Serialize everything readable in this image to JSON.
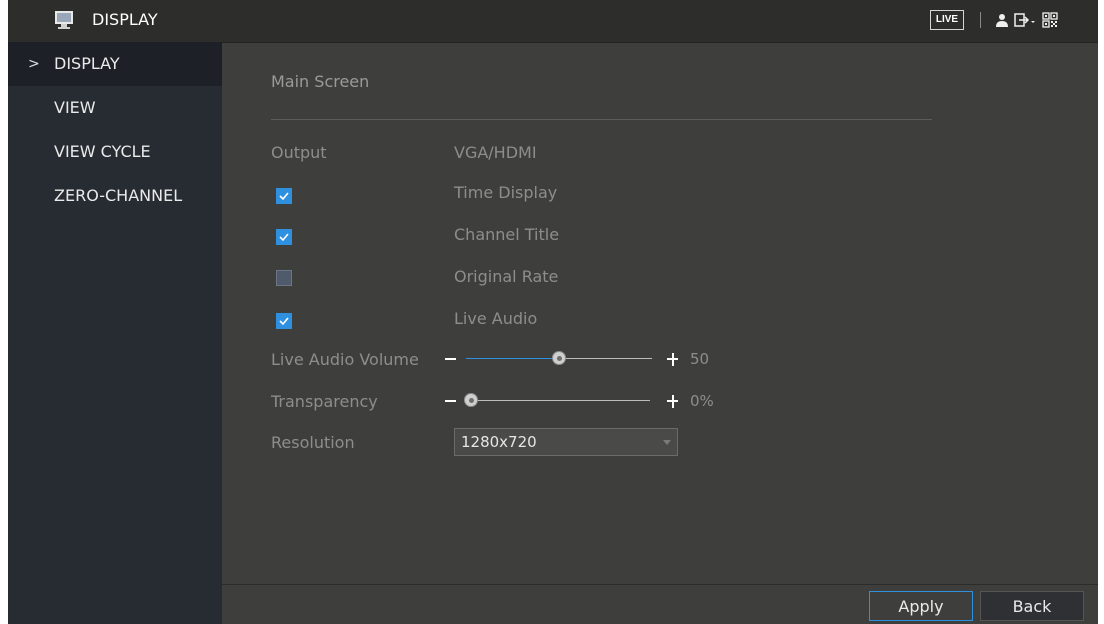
{
  "app": {
    "title": "DISPLAY"
  },
  "topbar": {
    "live_label": "LIVE"
  },
  "sidebar": {
    "items": [
      {
        "label": "DISPLAY",
        "active": true
      },
      {
        "label": "VIEW"
      },
      {
        "label": "VIEW CYCLE"
      },
      {
        "label": "ZERO-CHANNEL"
      }
    ]
  },
  "main": {
    "section_title": "Main Screen",
    "output": {
      "label": "Output",
      "value": "VGA/HDMI"
    },
    "checkboxes": [
      {
        "label": "Time Display",
        "checked": true
      },
      {
        "label": "Channel Title",
        "checked": true
      },
      {
        "label": "Original Rate",
        "checked": false
      },
      {
        "label": "Live Audio",
        "checked": true
      }
    ],
    "live_audio_volume": {
      "label": "Live Audio Volume",
      "value": 50,
      "display": "50"
    },
    "transparency": {
      "label": "Transparency",
      "value": 0,
      "display": "0%"
    },
    "resolution": {
      "label": "Resolution",
      "value": "1280x720"
    }
  },
  "buttons": {
    "apply": "Apply",
    "back": "Back"
  },
  "colors": {
    "accent": "#2f90e0",
    "sidebar": "#272c33",
    "content": "#3e3f3d"
  },
  "icons": [
    "monitor-icon",
    "user-icon",
    "logout-icon",
    "qr-code-icon",
    "chevron-right-icon",
    "checkmark-icon",
    "dropdown-caret-icon"
  ]
}
